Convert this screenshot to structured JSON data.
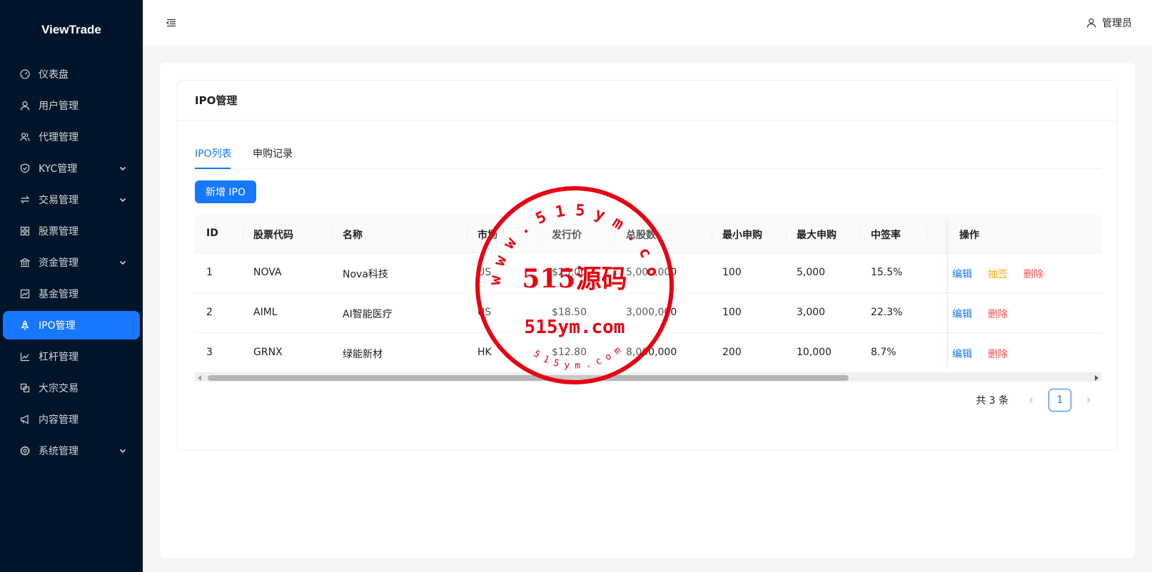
{
  "app": {
    "logo": "ViewTrade"
  },
  "sidebar": {
    "items": [
      {
        "label": "仪表盘",
        "icon": "dashboard-icon",
        "has_children": false
      },
      {
        "label": "用户管理",
        "icon": "user-icon",
        "has_children": false
      },
      {
        "label": "代理管理",
        "icon": "team-icon",
        "has_children": false
      },
      {
        "label": "KYC管理",
        "icon": "shield-icon",
        "has_children": true
      },
      {
        "label": "交易管理",
        "icon": "swap-icon",
        "has_children": true
      },
      {
        "label": "股票管理",
        "icon": "appstore-icon",
        "has_children": false
      },
      {
        "label": "资金管理",
        "icon": "bank-icon",
        "has_children": true
      },
      {
        "label": "基金管理",
        "icon": "fund-icon",
        "has_children": false
      },
      {
        "label": "IPO管理",
        "icon": "rocket-icon",
        "has_children": false,
        "active": true
      },
      {
        "label": "杠杆管理",
        "icon": "stock-icon",
        "has_children": false
      },
      {
        "label": "大宗交易",
        "icon": "block-icon",
        "has_children": false
      },
      {
        "label": "内容管理",
        "icon": "notification-icon",
        "has_children": false
      },
      {
        "label": "系统管理",
        "icon": "setting-icon",
        "has_children": true
      }
    ]
  },
  "header": {
    "user_label": "管理员"
  },
  "page": {
    "title": "IPO管理",
    "tabs": [
      {
        "label": "IPO列表",
        "active": true
      },
      {
        "label": "申购记录",
        "active": false
      }
    ],
    "add_button": "新增 IPO"
  },
  "table": {
    "columns": [
      "ID",
      "股票代码",
      "名称",
      "市场",
      "发行价",
      "总股数",
      "最小申购",
      "最大申购",
      "中签率",
      "操作"
    ],
    "rows": [
      {
        "id": "1",
        "code": "NOVA",
        "name": "Nova科技",
        "market": "US",
        "price": "$25.00",
        "shares": "5,000,000",
        "min": "100",
        "max": "5,000",
        "rate": "15.5%",
        "actions": [
          "编辑",
          "抽签",
          "删除"
        ]
      },
      {
        "id": "2",
        "code": "AIML",
        "name": "AI智能医疗",
        "market": "US",
        "price": "$18.50",
        "shares": "3,000,000",
        "min": "100",
        "max": "3,000",
        "rate": "22.3%",
        "actions": [
          "编辑",
          "删除"
        ]
      },
      {
        "id": "3",
        "code": "GRNX",
        "name": "绿能新材",
        "market": "HK",
        "price": "$12.80",
        "shares": "8,000,000",
        "min": "200",
        "max": "10,000",
        "rate": "8.7%",
        "actions": [
          "编辑",
          "删除"
        ]
      }
    ]
  },
  "pagination": {
    "total_text": "共 3 条",
    "current": "1"
  },
  "watermark": {
    "ring_text": "w w w . 5 1 5 y m . c o m",
    "center_text": "515源码",
    "domain_text": "515ym.com",
    "bottom_text": "5 1 5 y m . c o m",
    "color": "#e60012"
  },
  "colors": {
    "sidebar_bg": "#001529",
    "primary": "#1677ff",
    "warning": "#faad14",
    "danger": "#ff4d4f"
  }
}
